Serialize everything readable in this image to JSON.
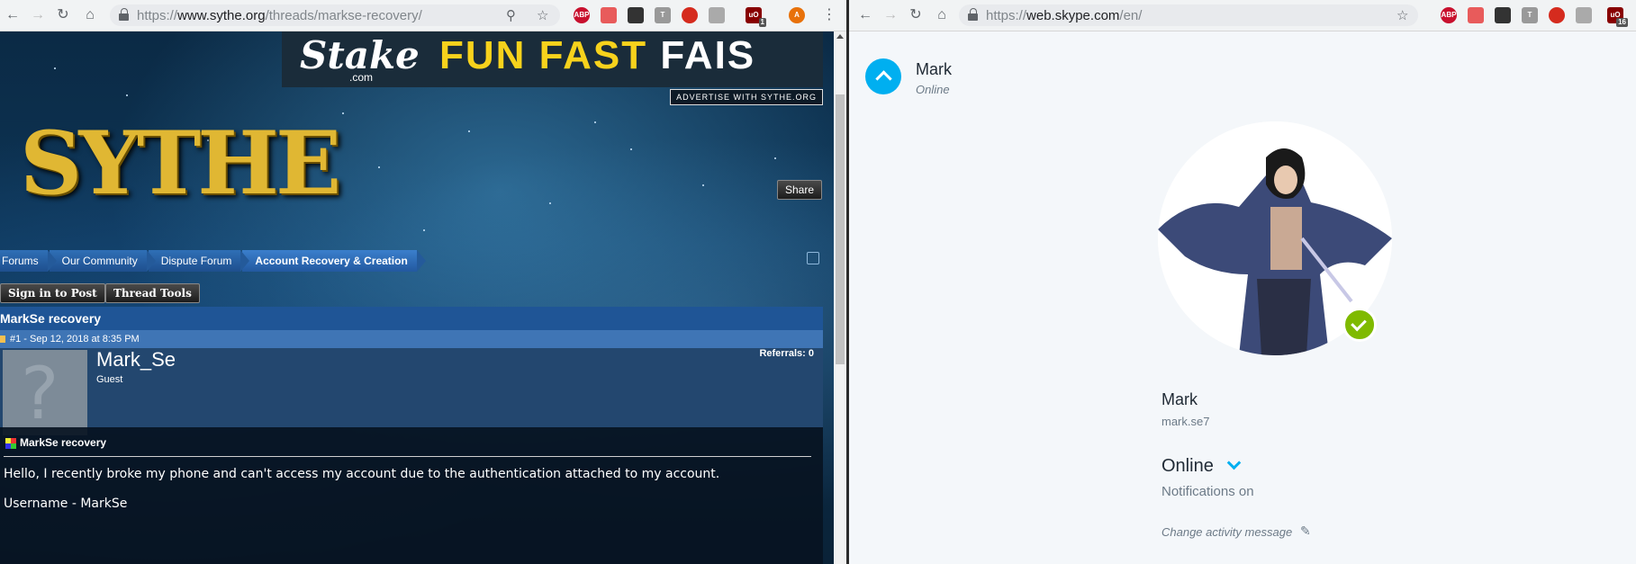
{
  "left_browser": {
    "url_scheme": "https://",
    "url_host": "www.sythe.org",
    "url_path": "/threads/markse-recovery/",
    "extensions": [
      "ABP",
      "",
      "",
      "T",
      "",
      "",
      "uO",
      "A"
    ],
    "ext_badge": "1"
  },
  "sythe": {
    "ad": {
      "logo": "Stake",
      "logo_sub": ".com",
      "slogan_1": "FUN",
      "slogan_2": "FAST",
      "slogan_3": "FAIS"
    },
    "advertise_label": "ADVERTISE WITH SYTHE.ORG",
    "logo_text": "SYTHE",
    "breadcrumbs": [
      "Forums",
      "Our Community",
      "Dispute Forum",
      "Account Recovery & Creation"
    ],
    "sign_in_label": "Sign in to Post",
    "thread_tools_label": "Thread Tools",
    "thread_title": "MarkSe recovery",
    "post_meta": "#1 - Sep 12, 2018 at 8:35 PM",
    "username": "Mark_Se",
    "user_title": "Guest",
    "referrals": "Referrals: 0",
    "post_title": "MarkSe recovery",
    "post_line_1": "Hello, I recently broke my phone and can't access my account due to the authentication attached to my account.",
    "post_line_2": "Username - MarkSe",
    "share_label": "Share"
  },
  "right_browser": {
    "url_scheme": "https://",
    "url_host": "web.skype.com",
    "url_path": "/en/",
    "extensions": [
      "ABP",
      "",
      "",
      "T",
      "",
      "",
      "uO"
    ],
    "ext_badge": "16"
  },
  "skype": {
    "header_name": "Mark",
    "header_status": "Online",
    "profile_name": "Mark",
    "profile_handle": "mark.se7",
    "status": "Online",
    "notifications": "Notifications on",
    "activity_placeholder": "Change activity message",
    "colors": {
      "accent": "#00aff0",
      "presence": "#7fba00"
    }
  }
}
